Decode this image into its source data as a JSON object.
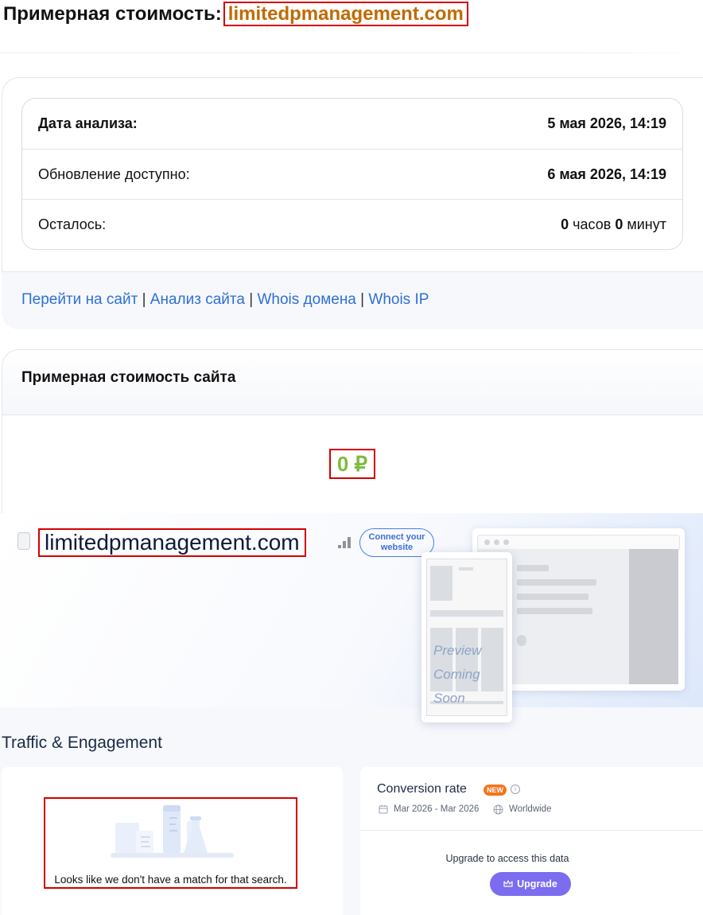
{
  "header": {
    "title_prefix": "Примерная стоимость:",
    "domain": "limitedpmanagement.com"
  },
  "analysis": {
    "rows": [
      {
        "label": "Дата анализа:",
        "value": "5 мая 2026, 14:19"
      },
      {
        "label": "Обновление доступно:",
        "value": "6 мая 2026, 14:19"
      },
      {
        "label": "Осталось:",
        "hours": "0",
        "hours_unit": "часов",
        "minutes": "0",
        "minutes_unit": "минут"
      }
    ],
    "links": [
      {
        "label": "Перейти на сайт"
      },
      {
        "label": "Анализ сайта"
      },
      {
        "label": "Whois домена"
      },
      {
        "label": "Whois IP"
      }
    ],
    "separator": "|"
  },
  "value_card": {
    "title": "Примерная стоимость сайта",
    "price": "0 ₽"
  },
  "similarweb": {
    "site_name": "limitedpmanagement.com",
    "connect_button": "Connect your website",
    "preview_line1": "Preview",
    "preview_line2": "Coming Soon",
    "section_title": "Traffic & Engagement",
    "no_match_text": "Looks like we don't have a match for that search.",
    "conversion": {
      "title": "Conversion rate",
      "badge": "NEW",
      "date_range": "Mar 2026 - Mar 2026",
      "region": "Worldwide",
      "upgrade_text": "Upgrade to access this data",
      "upgrade_button": "Upgrade"
    }
  },
  "colors": {
    "domain_accent": "#c26a00",
    "link": "#2f6fd6",
    "price": "#7dbb3f",
    "highlight_border": "#d40000",
    "upgrade_button": "#7b6cf0",
    "new_badge": "#f5741f"
  }
}
